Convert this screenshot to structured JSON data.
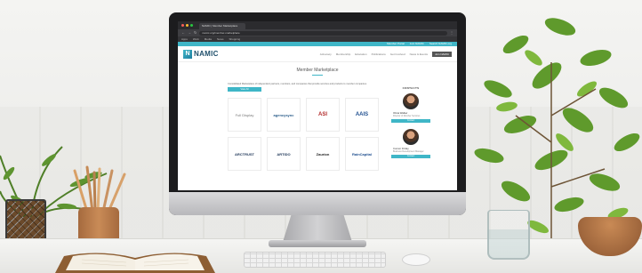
{
  "browser": {
    "tab_title": "NAMIC | Member Marketplace",
    "url": "namic.org/member-marketplace",
    "bookmarks": [
      "Apps",
      "Work",
      "Media",
      "News",
      "Shopping"
    ]
  },
  "site": {
    "utility_left": "",
    "utility_right": [
      "Member Portal",
      "Join NAMIC",
      "Search NAMIC.org"
    ],
    "logo_mark": "N",
    "logo_text": "NAMIC",
    "nav": [
      "Advocacy",
      "Membership",
      "Education",
      "Publications",
      "Get Involved",
      "News & Events",
      "Join NAMIC"
    ],
    "page_title": "Member Marketplace",
    "intro_text": "Consolidated Marketplace of independent partners, members, and companies that provide services and products to member companies.",
    "view_button": "View All",
    "contacts_heading": "CONTACTS",
    "tiles": [
      "Full Display",
      "agencysync",
      "ASI",
      "AAIS",
      "ARCTRUST",
      "ARTIDO",
      "Zaurion",
      "RainCapital"
    ],
    "contacts": [
      {
        "name": "Olivia Walker",
        "role": "Director of Member Services",
        "button": "Contact"
      },
      {
        "name": "Connor Friday",
        "role": "Business Development Manager",
        "button": "Contact"
      }
    ]
  },
  "colors": {
    "accent": "#3fb6c7",
    "brand_dark": "#1f4f6b"
  }
}
